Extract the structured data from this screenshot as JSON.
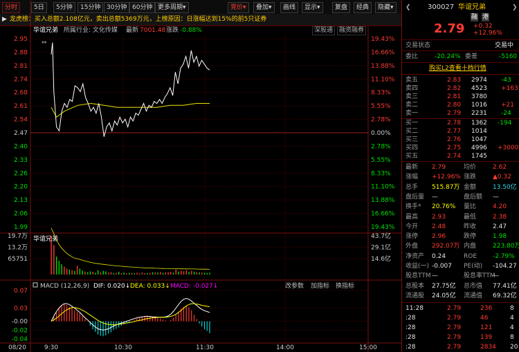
{
  "toolbar": {
    "items": [
      "分时",
      "5日",
      "5分钟",
      "15分钟",
      "30分钟",
      "60分钟",
      "更多周期",
      "竞价",
      "叠加",
      "画线",
      "显示",
      "复盘",
      "经典",
      "隐藏"
    ],
    "more_arrow": "▾",
    "right_arrow": "▶"
  },
  "dragon_tiger": "龙虎榜：买入总额2.108亿元，卖出总额5369万元，上榜原因：日涨幅达到15%的前5只证券",
  "chart_info": {
    "name": "华谊兄弟",
    "industry": "所属行业: 文化传媒",
    "latest_label": "最新",
    "latest_value": "7001.48",
    "change_label": "涨跌",
    "change_value": "-0.88%",
    "tag_deep": "深股通",
    "tag_margin": "融资融券"
  },
  "price_axis": {
    "left": [
      "2.95",
      "2.88",
      "2.81",
      "2.74",
      "2.68",
      "2.61",
      "2.54",
      "2.47",
      "2.40",
      "2.33",
      "2.26",
      "2.20",
      "2.13",
      "2.06",
      "1.99"
    ],
    "right": [
      "19.43%",
      "16.66%",
      "13.88%",
      "11.10%",
      "8.33%",
      "5.55%",
      "2.78%",
      "0.00%",
      "2.78%",
      "5.55%",
      "8.33%",
      "11.10%",
      "13.88%",
      "16.66%",
      "19.43%"
    ]
  },
  "lower_name": "华谊兄弟",
  "volume_axis": {
    "left": [
      "19.7万",
      "13.2万",
      "65751"
    ],
    "right": [
      "43.7亿",
      "29.1亿",
      "14.6亿"
    ]
  },
  "macd": {
    "label": "MACD (12,26,9)",
    "dif": "DIF: 0.020↓",
    "dea": "DEA: 0.033↓",
    "macd": "MACD: -0.027↓",
    "ticks": [
      "0.07",
      "0.03",
      "-0.00",
      "-0.02",
      "-0.04"
    ],
    "btns": [
      "改参数",
      "加指标",
      "换指标"
    ]
  },
  "time_axis": {
    "date": "08/20",
    "labels": [
      "9:30",
      "10:30",
      "11:30",
      "14:00",
      "15:00"
    ]
  },
  "quote": {
    "code": "300027",
    "name": "华谊兄弟",
    "tag1": "融",
    "tag2": "港",
    "price": "2.79",
    "chg": "+0.32",
    "pct": "+12.96%",
    "status_label": "交易状态",
    "status": "交易中",
    "wb_label": "委比",
    "wb": "-20.24%",
    "wc_label": "委差",
    "wc": "-5160",
    "l2_link": "购买L2查看十档行情",
    "sells": [
      {
        "label": "卖五",
        "price": "2.83",
        "vol": "2974",
        "chg": "-43"
      },
      {
        "label": "卖四",
        "price": "2.82",
        "vol": "4523",
        "chg": "+163"
      },
      {
        "label": "卖三",
        "price": "2.81",
        "vol": "3780",
        "chg": ""
      },
      {
        "label": "卖二",
        "price": "2.80",
        "vol": "1016",
        "chg": "+21"
      },
      {
        "label": "卖一",
        "price": "2.79",
        "vol": "2231",
        "chg": "-24"
      }
    ],
    "buys": [
      {
        "label": "买一",
        "price": "2.78",
        "vol": "1362",
        "chg": "-194"
      },
      {
        "label": "买二",
        "price": "2.77",
        "vol": "1014",
        "chg": ""
      },
      {
        "label": "买三",
        "price": "2.76",
        "vol": "1047",
        "chg": ""
      },
      {
        "label": "买四",
        "price": "2.75",
        "vol": "4996",
        "chg": "+3000"
      },
      {
        "label": "买五",
        "price": "2.74",
        "vol": "1745",
        "chg": ""
      }
    ],
    "stats": [
      {
        "l1": "最新",
        "v1": "2.79",
        "l2": "均价",
        "v2": "2.62"
      },
      {
        "l1": "涨幅",
        "v1": "+12.96%",
        "l2": "涨跌",
        "v2": "▲0.32"
      },
      {
        "l1": "总手",
        "v1": "515.87万",
        "l2": "金额",
        "v2": "13.50亿"
      },
      {
        "l1": "盘后量",
        "v1": "—",
        "l2": "盘后额",
        "v2": "—"
      },
      {
        "l1": "换手*",
        "v1": "20.76%",
        "l2": "量比",
        "v2": "4.20"
      },
      {
        "l1": "最高",
        "v1": "2.93",
        "l2": "最低",
        "v2": "2.38"
      },
      {
        "l1": "今开",
        "v1": "2.48",
        "l2": "昨收",
        "v2": "2.47"
      },
      {
        "l1": "涨停",
        "v1": "2.96",
        "l2": "跌停",
        "v2": "1.98"
      },
      {
        "l1": "外盘",
        "v1": "292.07万",
        "l2": "内盘",
        "v2": "223.80万"
      },
      {
        "l1": "净资产",
        "v1": "0.24",
        "l2": "ROE",
        "v2": "-2.79%"
      },
      {
        "l1": "收益(一)",
        "v1": "-0.007",
        "l2": "PE(动)",
        "v2": "-104.27"
      },
      {
        "l1": "股息TTM",
        "v1": "—",
        "l2": "股息率TTM",
        "v2": "—"
      },
      {
        "l1": "总股本",
        "v1": "27.75亿",
        "l2": "总市值",
        "v2": "77.41亿"
      },
      {
        "l1": "流通股",
        "v1": "24.05亿",
        "l2": "流通值",
        "v2": "69.32亿"
      }
    ],
    "ticks": [
      {
        "time": "11:28",
        "price": "2.79",
        "vol": "236",
        "n": "8"
      },
      {
        "time": ":28",
        "price": "2.79",
        "vol": "46",
        "n": "4"
      },
      {
        "time": ":28",
        "price": "2.79",
        "vol": "121",
        "n": "4"
      },
      {
        "time": ":28",
        "price": "2.79",
        "vol": "139",
        "n": "8"
      },
      {
        "time": ":28",
        "price": "2.79",
        "vol": "2834",
        "n": "20"
      }
    ]
  },
  "colors": {
    "up": "#ff3b30",
    "down": "#00e000",
    "price_line": "#ffffff",
    "avg_line": "#e6e600",
    "grid": "#5a0000"
  },
  "chart_data": [
    {
      "type": "line",
      "x_range": [
        "09:30",
        "15:00"
      ],
      "ylim": [
        1.99,
        2.95
      ],
      "prev_close": 2.47,
      "series": [
        {
          "name": "",
          "time": [
            "09:30",
            "09:31",
            "09:32",
            "09:34",
            "09:36",
            "09:38",
            "09:40",
            "09:42",
            "09:44",
            "09:46",
            "09:48",
            "09:50",
            "09:52",
            "09:54",
            "09:56",
            "09:58",
            "10:00",
            "10:02",
            "10:04",
            "10:06",
            "10:08",
            "10:10",
            "10:12",
            "10:14",
            "10:16",
            "10:18",
            "10:20",
            "10:22",
            "10:24",
            "10:26",
            "10:28",
            "10:30",
            "10:32",
            "10:34",
            "10:36",
            "10:38",
            "10:40",
            "10:42",
            "10:44",
            "10:46",
            "10:48",
            "10:50",
            "10:52",
            "10:54",
            "10:56",
            "10:58",
            "11:00",
            "11:02",
            "11:04",
            "11:06",
            "11:08",
            "11:10",
            "11:12",
            "11:14",
            "11:16",
            "11:18",
            "11:20",
            "11:22",
            "11:24",
            "11:26",
            "11:28",
            "11:30"
          ],
          "values": [
            2.87,
            2.93,
            2.68,
            2.5,
            2.48,
            2.58,
            2.62,
            2.6,
            2.64,
            2.63,
            2.71,
            2.7,
            2.68,
            2.72,
            2.65,
            2.62,
            2.58,
            2.6,
            2.57,
            2.62,
            2.55,
            2.45,
            2.5,
            2.52,
            2.48,
            2.53,
            2.51,
            2.55,
            2.52,
            2.54,
            2.5,
            2.55,
            2.53,
            2.57,
            2.56,
            2.59,
            2.62,
            2.58,
            2.61,
            2.6,
            2.63,
            2.62,
            2.64,
            2.62,
            2.65,
            2.67,
            2.7,
            2.66,
            2.78,
            2.72,
            2.8,
            2.82,
            2.86,
            2.8,
            2.89,
            2.83,
            2.86,
            2.81,
            2.84,
            2.82,
            2.8,
            2.79
          ]
        },
        {
          "name": "",
          "time": [
            "09:30",
            "09:34",
            "09:40",
            "09:50",
            "10:00",
            "10:10",
            "10:20",
            "10:30",
            "10:40",
            "10:50",
            "11:00",
            "11:10",
            "11:20",
            "11:30"
          ],
          "values": [
            2.6,
            2.55,
            2.58,
            2.61,
            2.62,
            2.61,
            2.6,
            2.6,
            2.6,
            2.6,
            2.61,
            2.61,
            2.62,
            2.62
          ]
        }
      ]
    },
    {
      "type": "bar",
      "ylim": [
        0,
        197000
      ],
      "series": [
        {
          "name": "",
          "values": [
            197000,
            150000,
            92000,
            70000,
            52000,
            40000,
            30000,
            25000,
            22000,
            18000,
            45000,
            30000,
            20000,
            15000,
            12000,
            16000,
            14000,
            9000,
            22000,
            11000,
            19000,
            16000,
            10000,
            12000,
            8000,
            9000,
            14000,
            7000,
            10000,
            6000,
            9000,
            8000,
            7000,
            9000,
            6000,
            10000,
            7000,
            8000,
            9000,
            12000,
            11000,
            10000,
            13000,
            9000,
            11000,
            12000,
            14000,
            10000,
            26000,
            15000,
            19000,
            17000,
            21000,
            14000,
            19000,
            15000,
            12000,
            11000,
            10000,
            9000,
            8000,
            9000
          ],
          "up": [
            true,
            true,
            false,
            false,
            false,
            true,
            true,
            false,
            true,
            false,
            true,
            false,
            false,
            true,
            false,
            false,
            true,
            false,
            false,
            true,
            false,
            false,
            true,
            true,
            false,
            true,
            false,
            true,
            false,
            true,
            false,
            true,
            false,
            true,
            true,
            true,
            true,
            false,
            true,
            false,
            true,
            false,
            true,
            false,
            true,
            true,
            true,
            false,
            true,
            false,
            true,
            true,
            true,
            false,
            true,
            false,
            true,
            false,
            true,
            false,
            false,
            false
          ]
        }
      ]
    },
    {
      "type": "bar",
      "ylim": [
        -0.04,
        0.07
      ],
      "series": [
        {
          "name": "MACD",
          "values": [
            0.0,
            0.01,
            0.02,
            0.03,
            0.035,
            0.04,
            0.037,
            0.033,
            0.03,
            0.025,
            0.022,
            0.018,
            0.012,
            0.005,
            0.0,
            -0.01,
            -0.018,
            -0.024,
            -0.03,
            -0.033,
            -0.034,
            -0.032,
            -0.028,
            -0.025,
            -0.02,
            -0.017,
            -0.014,
            -0.01,
            -0.007,
            -0.004,
            -0.002,
            0.0,
            0.003,
            0.006,
            0.008,
            0.01,
            0.012,
            0.013,
            0.012,
            0.011,
            0.01,
            0.008,
            0.006,
            0.004,
            0.002,
            0.0,
            0.003,
            0.008,
            0.015,
            0.022,
            0.028,
            0.033,
            0.035,
            0.032,
            0.025,
            0.015,
            0.005,
            -0.005,
            -0.012,
            -0.018,
            -0.022,
            -0.027
          ]
        },
        {
          "name": "DIF",
          "values": [
            0.0,
            0.012,
            0.022,
            0.03,
            0.036,
            0.04,
            0.04,
            0.038,
            0.034,
            0.03,
            0.025,
            0.02,
            0.014,
            0.008,
            0.003,
            -0.003,
            -0.008,
            -0.013,
            -0.017,
            -0.019,
            -0.02,
            -0.019,
            -0.017,
            -0.014,
            -0.011,
            -0.008,
            -0.006,
            -0.004,
            -0.002,
            0.0,
            0.002,
            0.004,
            0.006,
            0.008,
            0.009,
            0.01,
            0.011,
            0.011,
            0.011,
            0.01,
            0.01,
            0.009,
            0.009,
            0.009,
            0.01,
            0.012,
            0.016,
            0.022,
            0.03,
            0.038,
            0.045,
            0.05,
            0.052,
            0.05,
            0.046,
            0.041,
            0.036,
            0.031,
            0.027,
            0.024,
            0.022,
            0.02
          ]
        },
        {
          "name": "DEA",
          "values": [
            0.0,
            0.003,
            0.007,
            0.012,
            0.017,
            0.022,
            0.026,
            0.029,
            0.031,
            0.031,
            0.03,
            0.028,
            0.025,
            0.022,
            0.018,
            0.014,
            0.01,
            0.006,
            0.002,
            -0.001,
            -0.004,
            -0.006,
            -0.007,
            -0.008,
            -0.008,
            -0.008,
            -0.007,
            -0.006,
            -0.005,
            -0.004,
            -0.003,
            -0.002,
            -0.001,
            0.001,
            0.002,
            0.003,
            0.005,
            0.006,
            0.007,
            0.008,
            0.008,
            0.009,
            0.009,
            0.009,
            0.009,
            0.01,
            0.011,
            0.013,
            0.016,
            0.02,
            0.025,
            0.03,
            0.035,
            0.038,
            0.04,
            0.04,
            0.039,
            0.038,
            0.036,
            0.035,
            0.034,
            0.033
          ]
        }
      ]
    }
  ]
}
